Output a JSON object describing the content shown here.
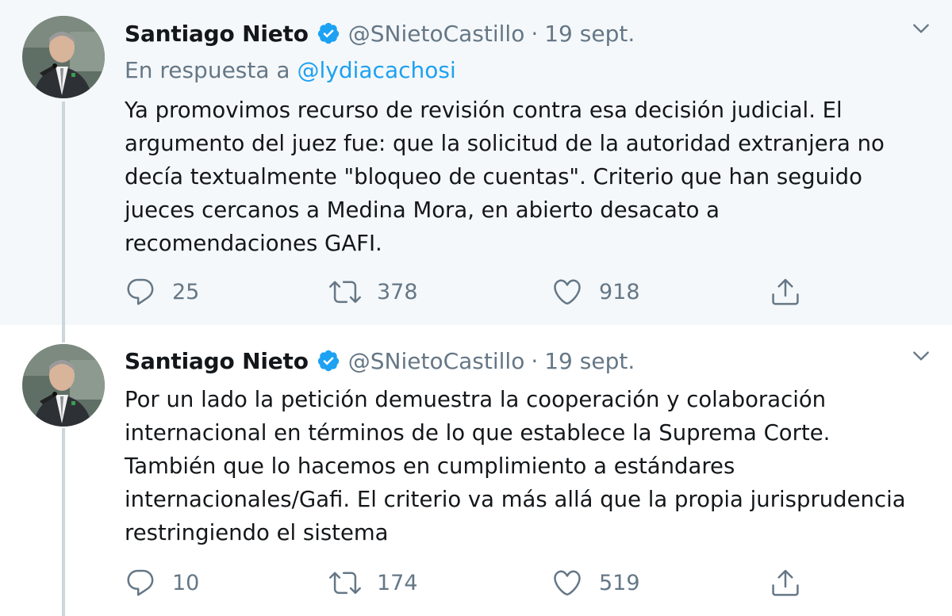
{
  "tweets": [
    {
      "display_name": "Santiago Nieto",
      "handle": "@SNietoCastillo",
      "separator": "·",
      "date": "19 sept.",
      "reply_prefix": "En respuesta a",
      "reply_to": "@lydiacachosi",
      "text": "Ya promovimos recurso de revisión contra esa decisión judicial. El argumento del juez fue: que la solicitud de la autoridad extranjera no decía textualmente \"bloqueo de cuentas\". Criterio que han seguido jueces cercanos a Medina Mora, en abierto desacato a recomendaciones GAFI.",
      "replies": "25",
      "retweets": "378",
      "likes": "918",
      "icons": {
        "verified": "verified-badge-icon",
        "more": "chevron-down-icon",
        "reply": "reply-bubble-icon",
        "retweet": "retweet-icon",
        "like": "heart-icon",
        "share": "share-icon"
      }
    },
    {
      "display_name": "Santiago Nieto",
      "handle": "@SNietoCastillo",
      "separator": "·",
      "date": "19 sept.",
      "text": "Por un lado la petición demuestra la cooperación y colaboración internacional en términos de lo que establece la Suprema Corte. También que lo hacemos en cumplimiento a estándares internacionales/Gafi. El criterio va más allá que la propia jurisprudencia restringiendo el sistema",
      "replies": "10",
      "retweets": "174",
      "likes": "519",
      "icons": {
        "verified": "verified-badge-icon",
        "more": "chevron-down-icon",
        "reply": "reply-bubble-icon",
        "retweet": "retweet-icon",
        "like": "heart-icon",
        "share": "share-icon"
      }
    }
  ],
  "colors": {
    "accent": "#1da1f2",
    "secondary_text": "#657786",
    "primary_text": "#14171a",
    "highlight_bg": "#f5f8fa",
    "thread_line": "#ccd6dd"
  }
}
